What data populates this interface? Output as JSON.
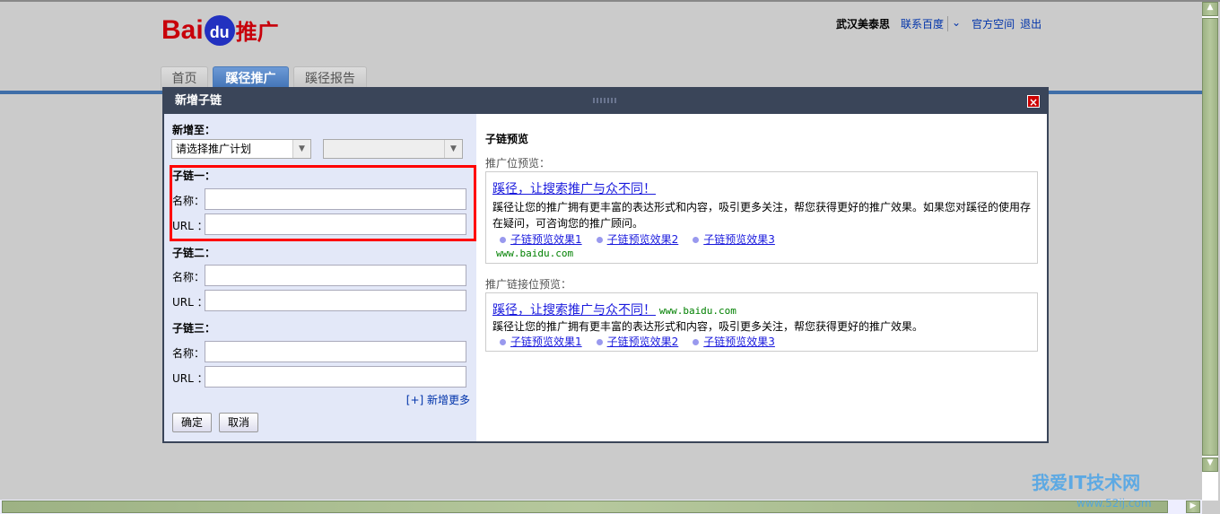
{
  "header": {
    "logo": "Baidu推广",
    "logo_parts": [
      "Bai",
      "du",
      "推广"
    ],
    "user": "武汉美泰思",
    "links": [
      "联系百度",
      "官方空间",
      "退出"
    ]
  },
  "tabs": [
    {
      "label": "首页",
      "active": false
    },
    {
      "label": "蹊径推广",
      "active": true
    },
    {
      "label": "蹊径报告",
      "active": false
    }
  ],
  "dialog": {
    "title": "新增子链",
    "left": {
      "add_to_label": "新增至：",
      "plan_select": "请选择推广计划",
      "unit_select": "",
      "groups": [
        {
          "label": "子链一：",
          "name_label": "名称：",
          "url_label": "URL ：",
          "name": "",
          "url": ""
        },
        {
          "label": "子链二：",
          "name_label": "名称：",
          "url_label": "URL ：",
          "name": "",
          "url": ""
        },
        {
          "label": "子链三：",
          "name_label": "名称：",
          "url_label": "URL ：",
          "name": "",
          "url": ""
        }
      ],
      "add_more": "[+] 新增更多",
      "ok": "确定",
      "cancel": "取消"
    },
    "right": {
      "title": "子链预览",
      "preview1_label": "推广位预览：",
      "preview2_label": "推广链接位预览：",
      "ad_title": "蹊径，让搜索推广与众不同！",
      "ad_desc1": "蹊径让您的推广拥有更丰富的表达形式和内容，吸引更多关注，帮您获得更好的推广效果。如果您对蹊径的使用存在疑问，可咨询您的推广顾问。",
      "ad_desc2": "蹊径让您的推广拥有更丰富的表达形式和内容，吸引更多关注，帮您获得更好的推广效果。",
      "sublinks": [
        "子链预览效果1",
        "子链预览效果2",
        "子链预览效果3"
      ],
      "url": "www.baidu.com"
    }
  },
  "watermark": {
    "text": "我爱IT技术网",
    "url": "www.52ij.com"
  },
  "colors": {
    "accent": "#3f6ea8",
    "dialog_title": "#3a4559",
    "highlight": "#ff0000"
  }
}
